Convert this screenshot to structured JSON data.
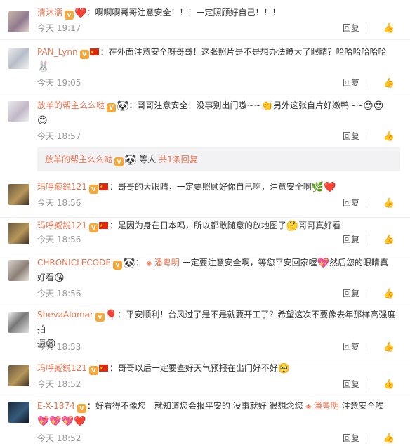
{
  "comments": [
    {
      "user": "清沐濡",
      "text": "：啊啊啊哥哥注意安全！！！一定照顾好自己！！！",
      "time": "今天 19:17",
      "reply": "回复",
      "like": "",
      "emoji_after_user": "❤️"
    },
    {
      "user": "PAN_Lynn",
      "text": "：在外面注意安全呀哥哥！这张照片是不是想办法瞪大了眼睛？哈哈哈哈哈哈",
      "time": "今天 19:05",
      "reply": "回复",
      "like": "",
      "emoji_trailing": "🐰"
    },
    {
      "user": "放羊的帮主么么哒",
      "text": "：哥哥注意安全！没事别出门嗷~~",
      "text2": "另外这张自片好嫩鸭~~",
      "time": "今天 18:57",
      "reply": "回复",
      "like": "",
      "emoji_mid": "👏",
      "emoji_end": "😍😍",
      "emoji_line2": "😍"
    },
    {
      "user": "玛呼臧鋭121",
      "text": "：哥哥的大眼睛，一定要照顾好你自己啊，注意安全啊",
      "time": "今天 18:56",
      "reply": "回复",
      "like": "",
      "emoji_end": "🌿❤️"
    },
    {
      "user": "玛呼臧鋭121",
      "text": "：是因为身在日本吗，所以都敢随意的放地图了",
      "text2": "哥哥真好看",
      "time": "今天 18:56",
      "reply": "回复",
      "like": "",
      "emoji_mid": "🤔"
    },
    {
      "user": "CHRONICLECODE",
      "text": "：",
      "mention": "潘粤明",
      "text2": " 一定要注意安全啊，等您平安回家喔",
      "text3": "然后您的眼睛真",
      "text4": "好看",
      "time": "今天 18:56",
      "reply": "回复",
      "like": "",
      "emoji_mid": "💖",
      "emoji_end": "😘",
      "emoji_after_user": "🐼"
    },
    {
      "user": "ShevaAlomar",
      "text": "：平安顺利！台风过了是不是就要开工了？希望这次不要像去年那样高强度拍",
      "text2": "摄",
      "time": "今天 18:53",
      "reply": "回复",
      "like": "",
      "emoji_end": "😩"
    },
    {
      "user": "玛呼臧鋭121",
      "text": "：哥哥以后一定要查好天气预报在出门好不好",
      "time": "今天 18:52",
      "reply": "回复",
      "like": "",
      "emoji_end": "🥺"
    },
    {
      "user": "E-X-1874",
      "text": "：好看得不像您　就知道您会报平安的 没事就好 很想念您",
      "mention": "潘粤明",
      "text2": " 注意安全唉",
      "time": "今天 18:52",
      "reply": "回复",
      "like": "",
      "emoji_line2": "💖💖💖❤️"
    }
  ],
  "subreply": {
    "user": "放羊的帮主么么哒",
    "middle": "等人",
    "more": "共1条回复"
  },
  "colors": {
    "accent": "#eb7350",
    "meta": "#999999",
    "sub_bg": "#f2f2f5"
  },
  "icons": {
    "like": "thumbs-up-icon",
    "badge": "vip-badge-icon",
    "flag": "china-flag-icon",
    "mention": "mention-eye-icon"
  }
}
